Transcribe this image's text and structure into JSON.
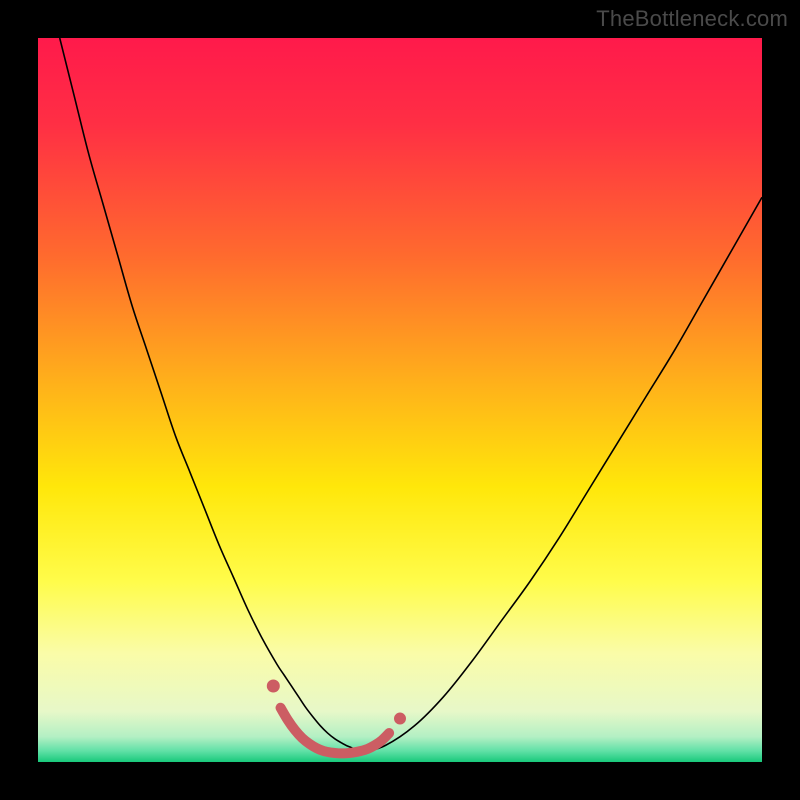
{
  "watermark": "TheBottleneck.com",
  "chart_data": {
    "type": "line",
    "title": "",
    "xlabel": "",
    "ylabel": "",
    "xlim": [
      0,
      100
    ],
    "ylim": [
      0,
      100
    ],
    "background_gradient": {
      "stops": [
        {
          "offset": 0.0,
          "color": "#ff1a4b"
        },
        {
          "offset": 0.12,
          "color": "#ff2f44"
        },
        {
          "offset": 0.3,
          "color": "#ff6a2e"
        },
        {
          "offset": 0.48,
          "color": "#ffb21a"
        },
        {
          "offset": 0.62,
          "color": "#ffe70a"
        },
        {
          "offset": 0.75,
          "color": "#fffc4a"
        },
        {
          "offset": 0.85,
          "color": "#fafca8"
        },
        {
          "offset": 0.93,
          "color": "#e7f8c8"
        },
        {
          "offset": 0.965,
          "color": "#b4f0c4"
        },
        {
          "offset": 0.985,
          "color": "#5fe0a6"
        },
        {
          "offset": 1.0,
          "color": "#18c97b"
        }
      ]
    },
    "series": [
      {
        "name": "bottleneck-curve",
        "color": "#000000",
        "stroke_width": 1.6,
        "x": [
          3,
          5,
          7,
          9,
          11,
          13,
          15,
          17,
          19,
          21,
          23,
          25,
          27,
          29,
          31,
          33,
          34,
          35,
          36,
          37,
          38,
          39,
          40,
          41,
          42,
          43,
          45,
          48,
          52,
          56,
          60,
          64,
          68,
          72,
          76,
          80,
          84,
          88,
          92,
          96,
          100
        ],
        "y": [
          100,
          92,
          84,
          77,
          70,
          63,
          57,
          51,
          45,
          40,
          35,
          30,
          25.5,
          21,
          17,
          13.5,
          12,
          10.5,
          9,
          7.5,
          6.2,
          5,
          4,
          3.2,
          2.6,
          2.1,
          1.5,
          2.3,
          5,
          9,
          14,
          19.5,
          25,
          31,
          37.5,
          44,
          50.5,
          57,
          64,
          71,
          78
        ]
      },
      {
        "name": "highlight-band",
        "color": "#cc5d63",
        "stroke_width": 10,
        "linecap": "round",
        "x": [
          33.5,
          34.5,
          35.5,
          36.5,
          37.5,
          38.5,
          39.5,
          40.5,
          41.5,
          42.5,
          43.5,
          44.5,
          45.5,
          46.5,
          47.5,
          48.5
        ],
        "y": [
          7.5,
          5.8,
          4.4,
          3.3,
          2.5,
          1.9,
          1.5,
          1.3,
          1.2,
          1.2,
          1.3,
          1.5,
          1.8,
          2.3,
          3.0,
          4.0
        ]
      }
    ],
    "markers": [
      {
        "name": "highlight-dot-left",
        "x": 32.5,
        "y": 10.5,
        "r": 6.5,
        "color": "#cc5d63"
      },
      {
        "name": "highlight-dot-right",
        "x": 50.0,
        "y": 6.0,
        "r": 6.0,
        "color": "#cc5d63"
      }
    ]
  }
}
